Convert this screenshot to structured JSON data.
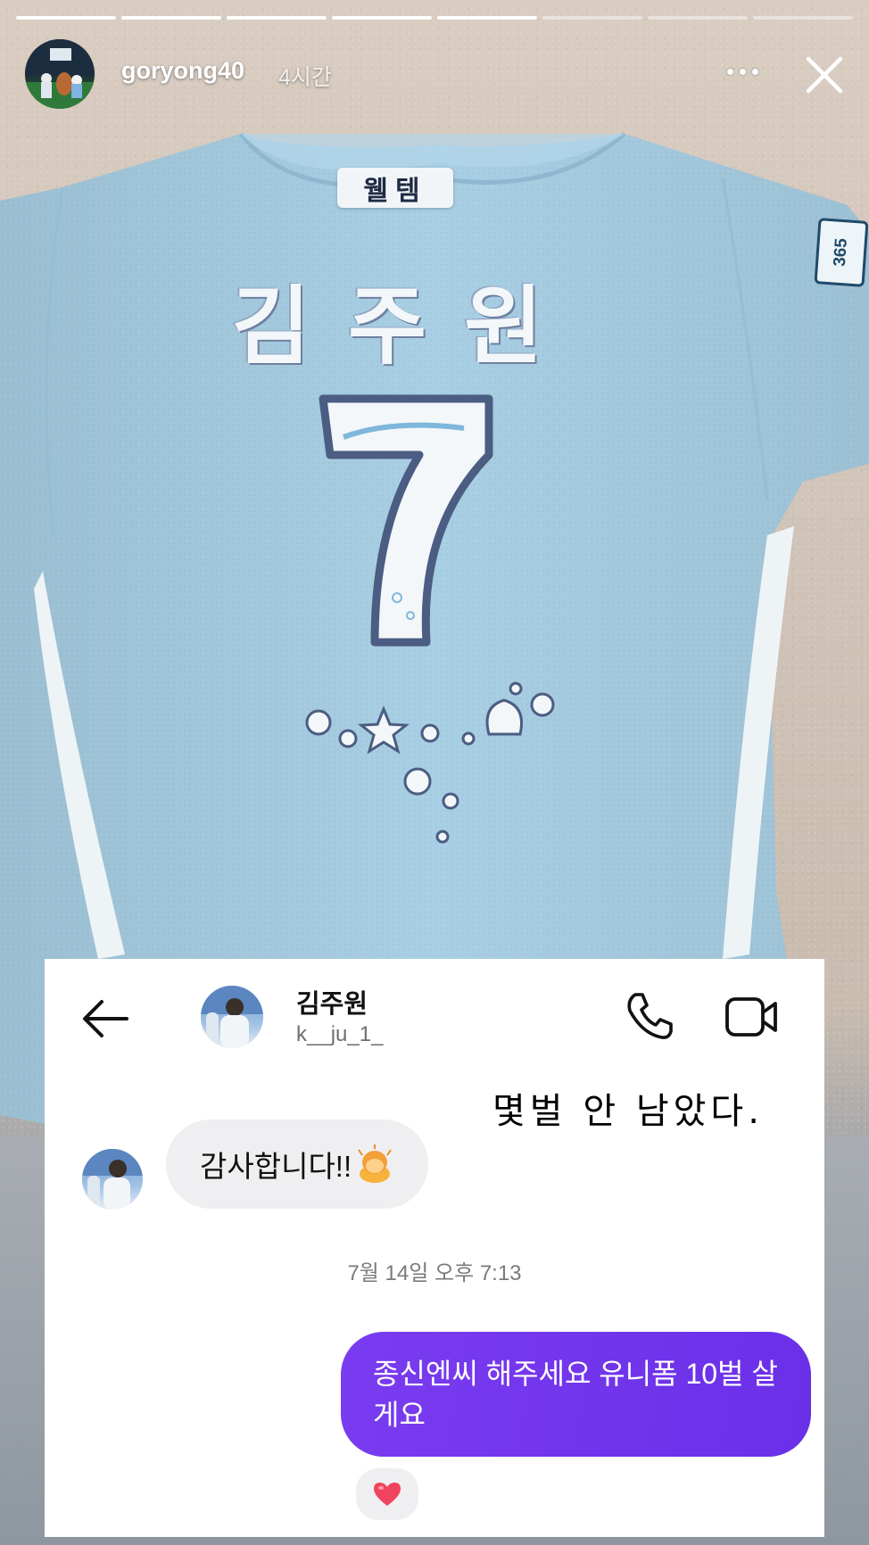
{
  "story": {
    "username": "goryong40",
    "time_ago": "4시간",
    "progress_total": 8,
    "progress_active": 5
  },
  "jersey": {
    "name_tag": "웰템",
    "sleeve_patch": "365",
    "player_name": "김주원",
    "number": "7"
  },
  "dm": {
    "contact_name": "김주원",
    "contact_handle": "k__ju_1_",
    "incoming_message": "감사합니다!!",
    "timestamp": "7월 14일 오후 7:13",
    "outgoing_message": "종신엔씨 해주세요 유니폼 10벌 살게요",
    "reaction": "heart"
  },
  "overlay_text": "몇벌 안 남았다.",
  "colors": {
    "jersey": "#a9cfe4",
    "outgoing_bubble": "#6f34ec",
    "incoming_bubble": "#efeff1",
    "heart": "#f0445e"
  }
}
